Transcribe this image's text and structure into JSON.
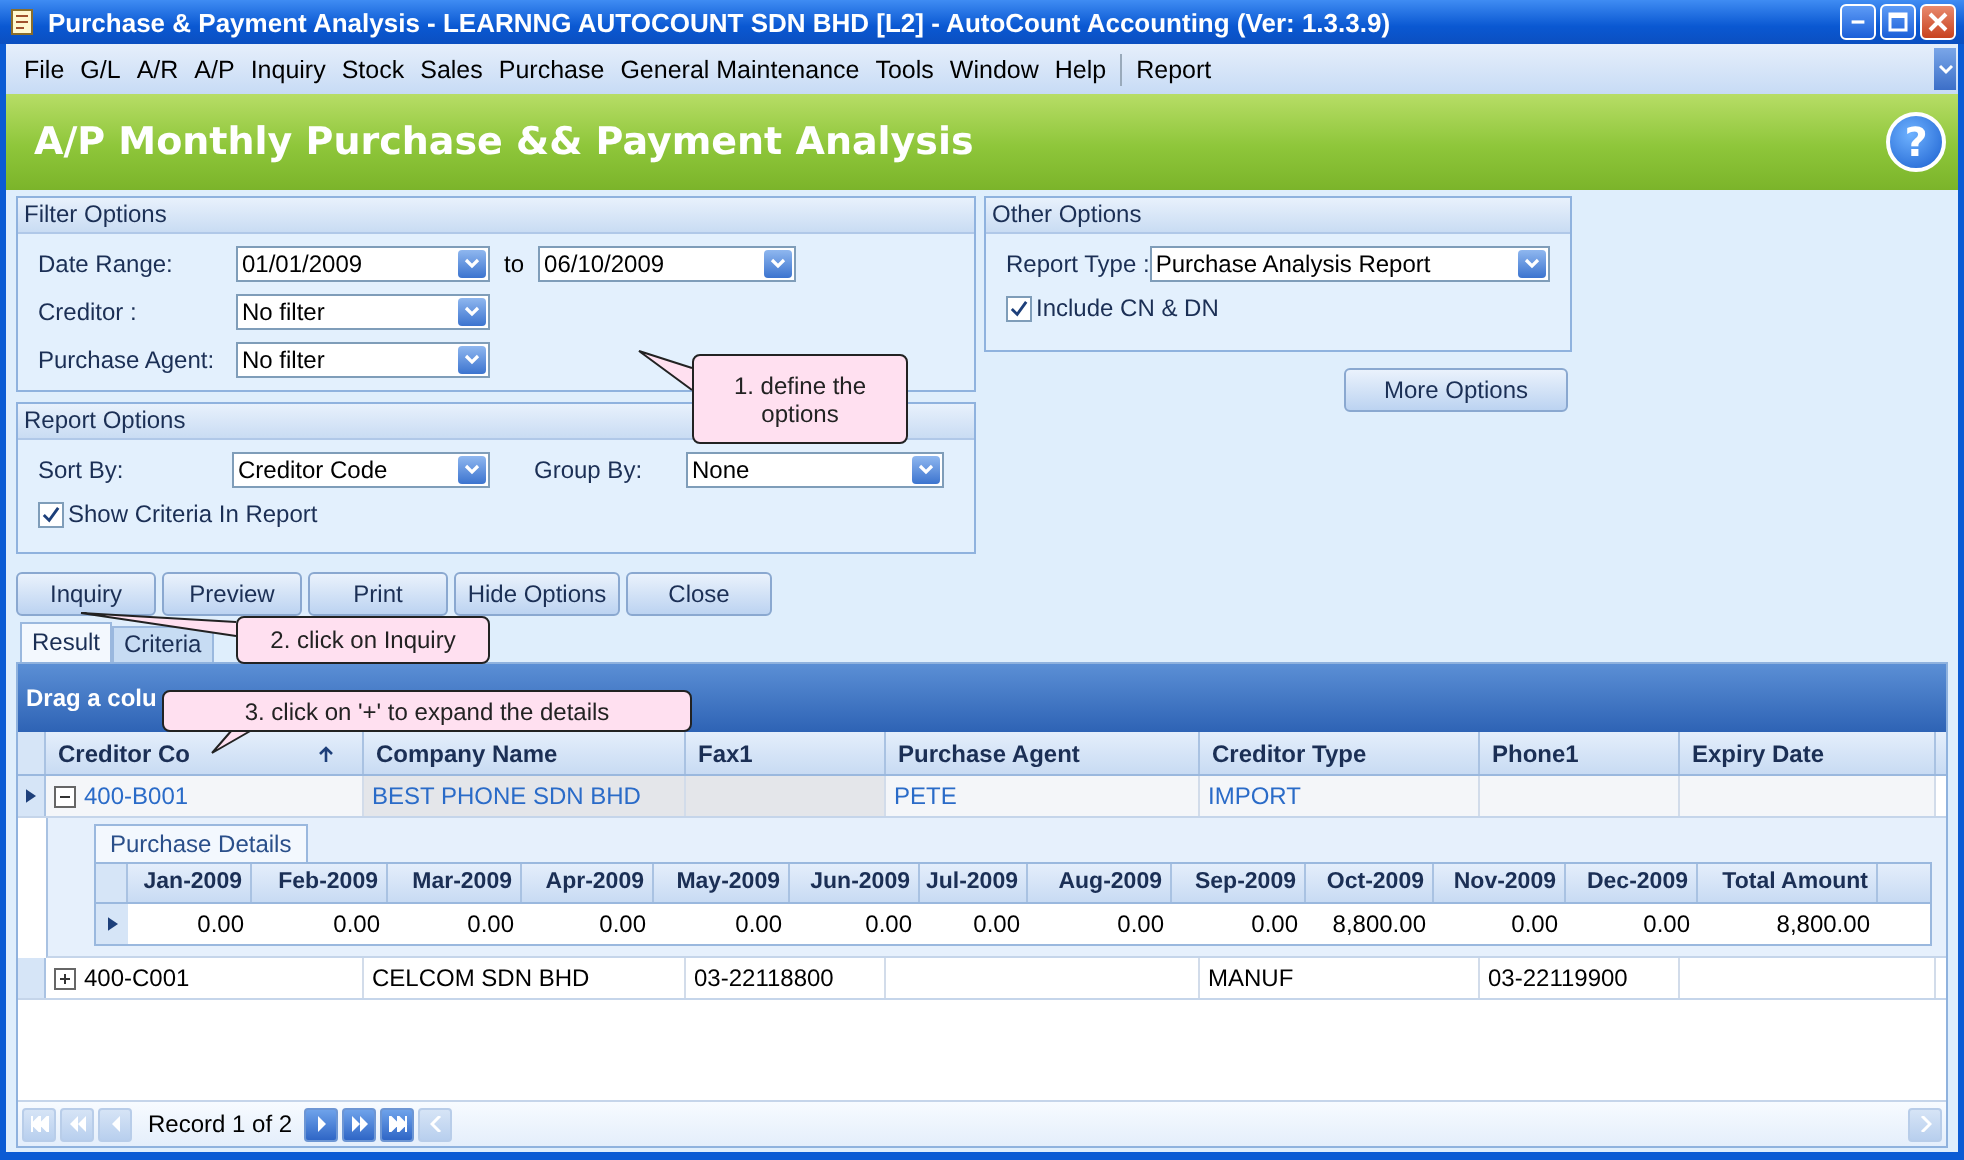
{
  "window": {
    "title": "Purchase & Payment Analysis - LEARNNG AUTOCOUNT SDN BHD [L2] - AutoCount Accounting (Ver: 1.3.3.9)"
  },
  "menu": [
    "File",
    "G/L",
    "A/R",
    "A/P",
    "Inquiry",
    "Stock",
    "Sales",
    "Purchase",
    "General Maintenance",
    "Tools",
    "Window",
    "Help",
    "Report"
  ],
  "header": {
    "title": "A/P Monthly Purchase && Payment Analysis",
    "help": "?"
  },
  "filter_options": {
    "title": "Filter Options",
    "fields": [
      {
        "label": "Date Range:",
        "value": "01/01/2009",
        "to_label": "to",
        "to_value": "06/10/2009"
      },
      {
        "label": "Creditor :",
        "value": "No filter"
      },
      {
        "label": "Purchase Agent:",
        "value": "No filter"
      }
    ]
  },
  "report_options": {
    "title": "Report Options",
    "sort_by": {
      "label": "Sort By:",
      "value": "Creditor Code"
    },
    "group_by": {
      "label": "Group By:",
      "value": "None"
    },
    "show_criteria": {
      "label": "Show Criteria In Report",
      "checked": true
    }
  },
  "other_options": {
    "title": "Other Options",
    "report_type": {
      "label": "Report Type :",
      "value": "Purchase Analysis Report"
    },
    "include_cn_dn": {
      "label": "Include CN & DN",
      "checked": true
    },
    "more_button": "More Options"
  },
  "buttons": [
    "Inquiry",
    "Preview",
    "Print",
    "Hide Options",
    "Close"
  ],
  "tabs": [
    {
      "label": "Result",
      "selected": true
    },
    {
      "label": "Criteria",
      "selected": false
    }
  ],
  "grid": {
    "group_panel_text": "Drag a colu",
    "columns": [
      {
        "label": "Creditor Co",
        "sort_ascending": true
      },
      {
        "label": "Company Name",
        "sort_ascending": false
      },
      {
        "label": "Fax1",
        "sort_ascending": false
      },
      {
        "label": "Purchase Agent",
        "sort_ascending": false
      },
      {
        "label": "Creditor Type",
        "sort_ascending": false
      },
      {
        "label": "Phone1",
        "sort_ascending": false
      },
      {
        "label": "Expiry Date",
        "sort_ascending": false
      }
    ],
    "rows": [
      {
        "selected": true,
        "expanded": true,
        "cells": [
          "400-B001",
          "BEST PHONE SDN BHD",
          null,
          "PETE",
          "IMPORT",
          null,
          null
        ],
        "details": {
          "tab": "Purchase Details",
          "columns": [
            "Jan-2009",
            "Feb-2009",
            "Mar-2009",
            "Apr-2009",
            "May-2009",
            "Jun-2009",
            "Jul-2009",
            "Aug-2009",
            "Sep-2009",
            "Oct-2009",
            "Nov-2009",
            "Dec-2009",
            "Total Amount"
          ],
          "rows": [
            {
              "selected": true,
              "cells": [
                "0.00",
                "0.00",
                "0.00",
                "0.00",
                "0.00",
                "0.00",
                "0.00",
                "0.00",
                "0.00",
                "8,800.00",
                "0.00",
                "0.00",
                "8,800.00"
              ]
            }
          ]
        }
      },
      {
        "selected": false,
        "expanded": false,
        "cells": [
          "400-C001",
          "CELCOM SDN BHD",
          "03-22118800",
          null,
          "MANUF",
          "03-22119900",
          null
        ]
      }
    ],
    "navigator": {
      "text": "Record 1 of 2"
    }
  },
  "callouts": [
    {
      "text": "1. define the options"
    },
    {
      "text": "2. click on Inquiry"
    },
    {
      "text": "3. click on '+' to expand the details"
    }
  ]
}
